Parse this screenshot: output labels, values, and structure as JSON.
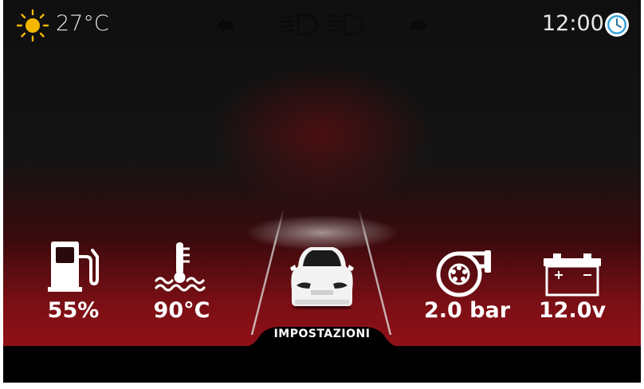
{
  "status_bar": {
    "temperature": "27°C",
    "time": "12:00",
    "weather_icon": "sun-icon",
    "clock_icon": "clock-icon",
    "left_indicator_icon": "turn-left-arrow-icon",
    "right_indicator_icon": "turn-right-arrow-icon",
    "headlight_icons": [
      "low-beam-icon",
      "high-beam-icon"
    ]
  },
  "gauges": {
    "fuel": {
      "value": "55%",
      "icon": "fuel-pump-icon"
    },
    "coolant": {
      "value": "90°C",
      "icon": "coolant-temperature-icon"
    },
    "turbo": {
      "value": "2.0 bar",
      "icon": "turbo-icon"
    },
    "battery": {
      "value": "12.0v",
      "icon": "battery-icon"
    }
  },
  "center": {
    "vehicle_icon": "car-icon"
  },
  "settings_tab": {
    "label": "IMPOSTAZIONI"
  },
  "colors": {
    "background_top": "#0f0f0f",
    "background_bottom": "#8e1016",
    "sun": "#f5b800",
    "clock": "#3aa3d8",
    "text": "#ffffff"
  }
}
